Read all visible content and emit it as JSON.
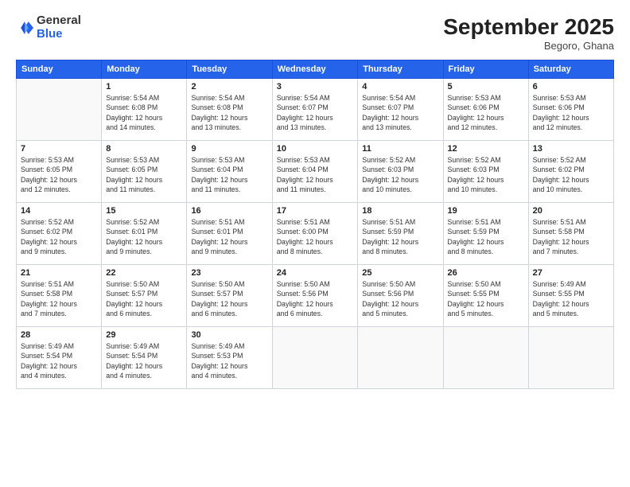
{
  "logo": {
    "general": "General",
    "blue": "Blue"
  },
  "header": {
    "month": "September 2025",
    "location": "Begoro, Ghana"
  },
  "weekdays": [
    "Sunday",
    "Monday",
    "Tuesday",
    "Wednesday",
    "Thursday",
    "Friday",
    "Saturday"
  ],
  "weeks": [
    [
      {
        "day": "",
        "info": ""
      },
      {
        "day": "1",
        "info": "Sunrise: 5:54 AM\nSunset: 6:08 PM\nDaylight: 12 hours\nand 14 minutes."
      },
      {
        "day": "2",
        "info": "Sunrise: 5:54 AM\nSunset: 6:08 PM\nDaylight: 12 hours\nand 13 minutes."
      },
      {
        "day": "3",
        "info": "Sunrise: 5:54 AM\nSunset: 6:07 PM\nDaylight: 12 hours\nand 13 minutes."
      },
      {
        "day": "4",
        "info": "Sunrise: 5:54 AM\nSunset: 6:07 PM\nDaylight: 12 hours\nand 13 minutes."
      },
      {
        "day": "5",
        "info": "Sunrise: 5:53 AM\nSunset: 6:06 PM\nDaylight: 12 hours\nand 12 minutes."
      },
      {
        "day": "6",
        "info": "Sunrise: 5:53 AM\nSunset: 6:06 PM\nDaylight: 12 hours\nand 12 minutes."
      }
    ],
    [
      {
        "day": "7",
        "info": "Sunrise: 5:53 AM\nSunset: 6:05 PM\nDaylight: 12 hours\nand 12 minutes."
      },
      {
        "day": "8",
        "info": "Sunrise: 5:53 AM\nSunset: 6:05 PM\nDaylight: 12 hours\nand 11 minutes."
      },
      {
        "day": "9",
        "info": "Sunrise: 5:53 AM\nSunset: 6:04 PM\nDaylight: 12 hours\nand 11 minutes."
      },
      {
        "day": "10",
        "info": "Sunrise: 5:53 AM\nSunset: 6:04 PM\nDaylight: 12 hours\nand 11 minutes."
      },
      {
        "day": "11",
        "info": "Sunrise: 5:52 AM\nSunset: 6:03 PM\nDaylight: 12 hours\nand 10 minutes."
      },
      {
        "day": "12",
        "info": "Sunrise: 5:52 AM\nSunset: 6:03 PM\nDaylight: 12 hours\nand 10 minutes."
      },
      {
        "day": "13",
        "info": "Sunrise: 5:52 AM\nSunset: 6:02 PM\nDaylight: 12 hours\nand 10 minutes."
      }
    ],
    [
      {
        "day": "14",
        "info": "Sunrise: 5:52 AM\nSunset: 6:02 PM\nDaylight: 12 hours\nand 9 minutes."
      },
      {
        "day": "15",
        "info": "Sunrise: 5:52 AM\nSunset: 6:01 PM\nDaylight: 12 hours\nand 9 minutes."
      },
      {
        "day": "16",
        "info": "Sunrise: 5:51 AM\nSunset: 6:01 PM\nDaylight: 12 hours\nand 9 minutes."
      },
      {
        "day": "17",
        "info": "Sunrise: 5:51 AM\nSunset: 6:00 PM\nDaylight: 12 hours\nand 8 minutes."
      },
      {
        "day": "18",
        "info": "Sunrise: 5:51 AM\nSunset: 5:59 PM\nDaylight: 12 hours\nand 8 minutes."
      },
      {
        "day": "19",
        "info": "Sunrise: 5:51 AM\nSunset: 5:59 PM\nDaylight: 12 hours\nand 8 minutes."
      },
      {
        "day": "20",
        "info": "Sunrise: 5:51 AM\nSunset: 5:58 PM\nDaylight: 12 hours\nand 7 minutes."
      }
    ],
    [
      {
        "day": "21",
        "info": "Sunrise: 5:51 AM\nSunset: 5:58 PM\nDaylight: 12 hours\nand 7 minutes."
      },
      {
        "day": "22",
        "info": "Sunrise: 5:50 AM\nSunset: 5:57 PM\nDaylight: 12 hours\nand 6 minutes."
      },
      {
        "day": "23",
        "info": "Sunrise: 5:50 AM\nSunset: 5:57 PM\nDaylight: 12 hours\nand 6 minutes."
      },
      {
        "day": "24",
        "info": "Sunrise: 5:50 AM\nSunset: 5:56 PM\nDaylight: 12 hours\nand 6 minutes."
      },
      {
        "day": "25",
        "info": "Sunrise: 5:50 AM\nSunset: 5:56 PM\nDaylight: 12 hours\nand 5 minutes."
      },
      {
        "day": "26",
        "info": "Sunrise: 5:50 AM\nSunset: 5:55 PM\nDaylight: 12 hours\nand 5 minutes."
      },
      {
        "day": "27",
        "info": "Sunrise: 5:49 AM\nSunset: 5:55 PM\nDaylight: 12 hours\nand 5 minutes."
      }
    ],
    [
      {
        "day": "28",
        "info": "Sunrise: 5:49 AM\nSunset: 5:54 PM\nDaylight: 12 hours\nand 4 minutes."
      },
      {
        "day": "29",
        "info": "Sunrise: 5:49 AM\nSunset: 5:54 PM\nDaylight: 12 hours\nand 4 minutes."
      },
      {
        "day": "30",
        "info": "Sunrise: 5:49 AM\nSunset: 5:53 PM\nDaylight: 12 hours\nand 4 minutes."
      },
      {
        "day": "",
        "info": ""
      },
      {
        "day": "",
        "info": ""
      },
      {
        "day": "",
        "info": ""
      },
      {
        "day": "",
        "info": ""
      }
    ]
  ]
}
